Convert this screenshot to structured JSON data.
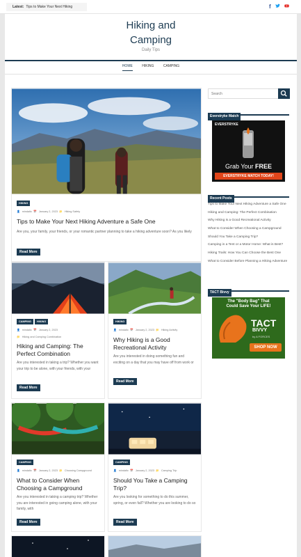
{
  "topbar": {
    "latest_label": "Latest:",
    "latest_text": "Tips to Make Your Next Hiking",
    "social": [
      {
        "icon": "facebook-icon",
        "glyph": "f",
        "color": "#3b5998"
      },
      {
        "icon": "twitter-icon",
        "glyph": "🐦",
        "color": "#1da1f2"
      },
      {
        "icon": "youtube-icon",
        "glyph": "▶",
        "color": "#e52d27"
      }
    ]
  },
  "site": {
    "title_line1": "Hiking and",
    "title_line2": "Camping",
    "description": "Daily Tips"
  },
  "nav": {
    "items": [
      "HOME",
      "HIKING",
      "CAMPING"
    ]
  },
  "posts": {
    "featured": {
      "tags": [
        "HIKING"
      ],
      "author": "mindaltc",
      "date": "January 2, 2023",
      "category": "Hiking Safety",
      "title": "Tips to Make Your Next Hiking Adventure a Safe One",
      "excerpt": "Are you, your family, your friends, or your romantic partner planning to take a hiking adventure soon? As you likely",
      "button": "Read More"
    },
    "grid": [
      {
        "tags": [
          "CAMPING",
          "HIKING"
        ],
        "author": "mindaltc",
        "date": "January 2, 2023",
        "category": "Hiking and Camping Combination",
        "title": "Hiking and Camping: The Perfect Combination",
        "excerpt": "Are you interested in taking a trip? Whether you want your trip to be alone, with your friends, with your",
        "button": "Read More"
      },
      {
        "tags": [
          "HIKING"
        ],
        "author": "mindaltc",
        "date": "January 2, 2023",
        "category": "Hiking Activity",
        "title": "Why Hiking is a Good Recreational Activity",
        "excerpt": "Are you interested in doing something fun and exciting on a day that you may have off from work or",
        "button": "Read More"
      },
      {
        "tags": [
          "CAMPING"
        ],
        "author": "mindaltc",
        "date": "January 2, 2023",
        "category": "Choosing Campground",
        "title": "What to Consider When Choosing a Campground",
        "excerpt": "Are you interested in taking a camping trip? Whether you are interested in going camping alone, with your family, with",
        "button": "Read More"
      },
      {
        "tags": [
          "CAMPING"
        ],
        "author": "mindaltc",
        "date": "January 2, 2023",
        "category": "Camping Trip",
        "title": "Should You Take a Camping Trip?",
        "excerpt": "Are you looking for something to do this summer, spring, or even fall? Whether you are looking to do so",
        "button": "Read More"
      }
    ]
  },
  "sidebar": {
    "search_placeholder": "Search",
    "widget1_title": "Everstryke Match",
    "ad1": {
      "brand": "EVERSTRYKE",
      "line1": "Grab Your",
      "free": "FREE",
      "line2": "EVERSTRYKE MATCH TODAY!"
    },
    "recent_title": "Recent Posts",
    "recent_posts": [
      "Tips to Make Your Next Hiking Adventure a Safe One",
      "Hiking and Camping: The Perfect Combination",
      "Why Hiking is a Good Recreational Activity",
      "What to Consider When Choosing a Campground",
      "Should You Take a Camping Trip?",
      "Camping in a Tent or a Motor Home: What is Best?",
      "Hiking Trails: How You Can Choose the Best One",
      "What to Consider Before Planning a Hiking Adventure"
    ],
    "widget3_title": "TACT Bivvy",
    "ad2": {
      "headline1": "The \"Body Bag\" That",
      "headline2": "Could Save Your LIFE!",
      "brand": "TACT",
      "brand2": "BIVVY",
      "by": "by A FORCES",
      "cta": "SHOP NOW"
    }
  },
  "colors": {
    "primary": "#1c3b52",
    "ad_orange": "#e8731c",
    "ad_green": "#2a8a2a"
  }
}
